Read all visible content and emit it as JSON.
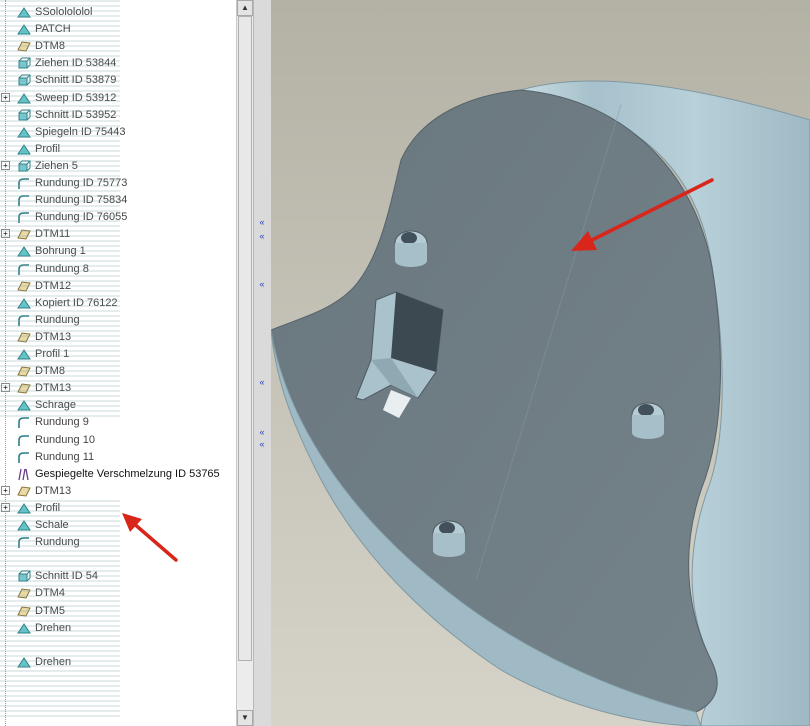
{
  "model_tree": {
    "items": [
      {
        "label": "SSololololol",
        "expander": "",
        "icon": "sketch-icon"
      },
      {
        "label": "PATCH",
        "expander": "",
        "icon": "surface-icon"
      },
      {
        "label": "DTM8",
        "expander": "",
        "icon": "datum-plane-icon"
      },
      {
        "label": "Ziehen ID 53844",
        "expander": "",
        "icon": "extrude-icon"
      },
      {
        "label": "Schnitt ID 53879",
        "expander": "",
        "icon": "cut-icon"
      },
      {
        "label": "Sweep ID 53912",
        "expander": "+",
        "icon": "sweep-icon"
      },
      {
        "label": "Schnitt ID 53952",
        "expander": "",
        "icon": "cut-icon"
      },
      {
        "label": "Spiegeln ID 75443",
        "expander": "",
        "icon": "mirror-icon"
      },
      {
        "label": "Profil",
        "expander": "",
        "icon": "profile-icon"
      },
      {
        "label": "Ziehen 5",
        "expander": "+",
        "icon": "extrude-icon"
      },
      {
        "label": "Rundung ID 75773",
        "expander": "",
        "icon": "round-icon"
      },
      {
        "label": "Rundung ID 75834",
        "expander": "",
        "icon": "round-icon"
      },
      {
        "label": "Rundung ID 76055",
        "expander": "",
        "icon": "round-icon"
      },
      {
        "label": "DTM11",
        "expander": "+",
        "icon": "datum-plane-icon"
      },
      {
        "label": "Bohrung 1",
        "expander": "",
        "icon": "hole-icon"
      },
      {
        "label": "Rundung 8",
        "expander": "",
        "icon": "round-icon"
      },
      {
        "label": "DTM12",
        "expander": "",
        "icon": "datum-plane-icon"
      },
      {
        "label": "Kopiert ID 76122",
        "expander": "",
        "icon": "copy-icon"
      },
      {
        "label": "Rundung",
        "expander": "",
        "icon": "round-icon"
      },
      {
        "label": "DTM13",
        "expander": "",
        "icon": "datum-plane-icon"
      },
      {
        "label": "Profil 1",
        "expander": "",
        "icon": "profile-icon"
      },
      {
        "label": "DTM8",
        "expander": "",
        "icon": "datum-plane-icon"
      },
      {
        "label": "DTM13",
        "expander": "+",
        "icon": "datum-plane-icon"
      },
      {
        "label": "Schrage",
        "expander": "",
        "icon": "draft-icon"
      },
      {
        "label": "Rundung 9",
        "expander": "",
        "icon": "round-icon"
      },
      {
        "label": "Rundung 10",
        "expander": "",
        "icon": "round-icon"
      },
      {
        "label": "Rundung 11",
        "expander": "",
        "icon": "round-icon"
      },
      {
        "label": "Gespiegelte Verschmelzung ID 53765",
        "expander": "",
        "icon": "blend-icon"
      },
      {
        "label": "DTM13",
        "expander": "+",
        "icon": "datum-plane-icon"
      },
      {
        "label": "Profil",
        "expander": "+",
        "icon": "profile-icon"
      },
      {
        "label": "Schale",
        "expander": "",
        "icon": "shell-icon"
      },
      {
        "label": "Rundung",
        "expander": "",
        "icon": "round-icon"
      },
      {
        "label": "",
        "expander": "",
        "icon": ""
      },
      {
        "label": "Schnitt ID 54",
        "expander": "",
        "icon": "cut-icon"
      },
      {
        "label": "DTM4",
        "expander": "",
        "icon": "datum-plane-icon"
      },
      {
        "label": "DTM5",
        "expander": "",
        "icon": "datum-plane-icon"
      },
      {
        "label": "Drehen",
        "expander": "",
        "icon": "revolve-icon"
      },
      {
        "label": "",
        "expander": "",
        "icon": ""
      },
      {
        "label": "Drehen",
        "expander": "",
        "icon": "revolve-icon"
      }
    ]
  },
  "colors": {
    "annotation_arrow": "#d8261a",
    "part_face": "#6f7c84",
    "part_skin": "#a9c4cf",
    "viewport_bg": "#c2bfb4",
    "sash_arrow": "#2a45c8"
  },
  "scrollbar": {
    "up_glyph": "▲",
    "down_glyph": "▼"
  },
  "sash": {
    "arrow_glyph": "«"
  }
}
